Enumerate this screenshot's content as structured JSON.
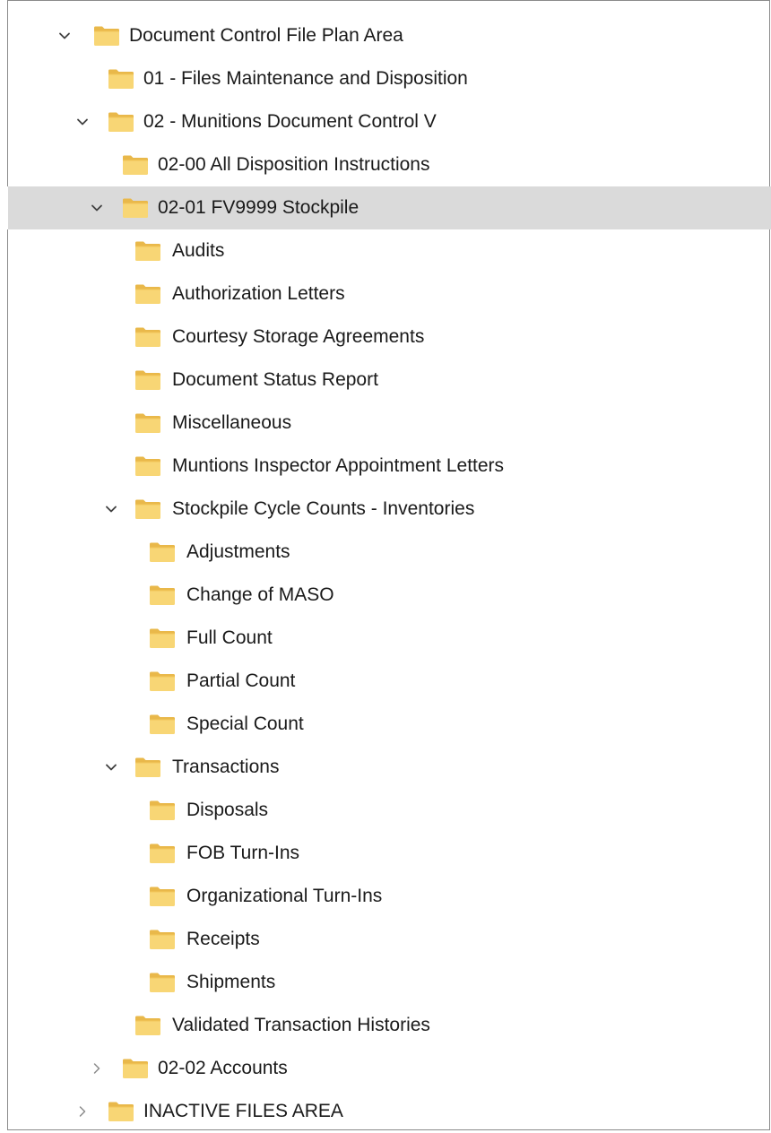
{
  "colors": {
    "folder_body": "#f8d675",
    "folder_tab": "#e9b84a",
    "selection": "#dadada",
    "chevron": "#404040"
  },
  "tree": {
    "items": [
      {
        "label": "Document Control File Plan Area",
        "state": "expanded",
        "level": 0
      },
      {
        "label": "01 - Files Maintenance and Disposition",
        "state": "leaf",
        "level": 1
      },
      {
        "label": "02 - Munitions Document Control V",
        "state": "expanded",
        "level": 1
      },
      {
        "label": "02-00 All Disposition Instructions",
        "state": "leaf",
        "level": 2
      },
      {
        "label": "02-01 FV9999 Stockpile",
        "state": "expanded",
        "level": 2,
        "selected": true
      },
      {
        "label": "Audits",
        "state": "leaf",
        "level": 3
      },
      {
        "label": "Authorization Letters",
        "state": "leaf",
        "level": 3
      },
      {
        "label": "Courtesy Storage Agreements",
        "state": "leaf",
        "level": 3
      },
      {
        "label": "Document Status Report",
        "state": "leaf",
        "level": 3
      },
      {
        "label": "Miscellaneous",
        "state": "leaf",
        "level": 3
      },
      {
        "label": "Muntions Inspector Appointment Letters",
        "state": "leaf",
        "level": 3
      },
      {
        "label": "Stockpile Cycle Counts - Inventories",
        "state": "expanded",
        "level": 3
      },
      {
        "label": "Adjustments",
        "state": "leaf",
        "level": 4
      },
      {
        "label": "Change of MASO",
        "state": "leaf",
        "level": 4
      },
      {
        "label": "Full Count",
        "state": "leaf",
        "level": 4
      },
      {
        "label": "Partial Count",
        "state": "leaf",
        "level": 4
      },
      {
        "label": "Special Count",
        "state": "leaf",
        "level": 4
      },
      {
        "label": "Transactions",
        "state": "expanded",
        "level": 3
      },
      {
        "label": "Disposals",
        "state": "leaf",
        "level": 4
      },
      {
        "label": "FOB Turn-Ins",
        "state": "leaf",
        "level": 4
      },
      {
        "label": "Organizational Turn-Ins",
        "state": "leaf",
        "level": 4
      },
      {
        "label": "Receipts",
        "state": "leaf",
        "level": 4
      },
      {
        "label": "Shipments",
        "state": "leaf",
        "level": 4
      },
      {
        "label": "Validated Transaction Histories",
        "state": "leaf",
        "level": 3
      },
      {
        "label": "02-02 Accounts",
        "state": "collapsed",
        "level": 2
      },
      {
        "label": "INACTIVE FILES AREA",
        "state": "collapsed",
        "level": 1
      }
    ]
  }
}
